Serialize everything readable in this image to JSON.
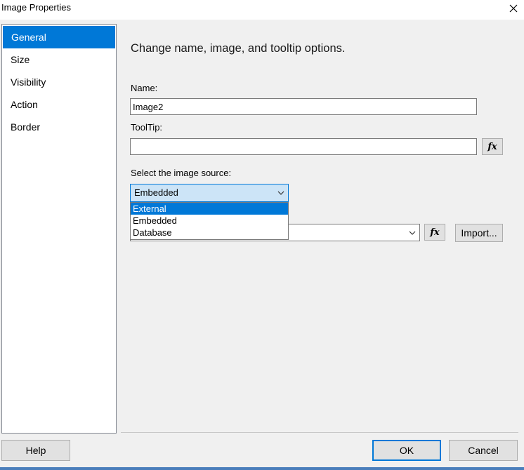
{
  "window": {
    "title": "Image Properties"
  },
  "nav": {
    "items": [
      {
        "label": "General",
        "selected": true
      },
      {
        "label": "Size",
        "selected": false
      },
      {
        "label": "Visibility",
        "selected": false
      },
      {
        "label": "Action",
        "selected": false
      },
      {
        "label": "Border",
        "selected": false
      }
    ]
  },
  "main": {
    "heading": "Change name, image, and tooltip options.",
    "name_label": "Name:",
    "name_value": "Image2",
    "tooltip_label": "ToolTip:",
    "tooltip_value": "",
    "source_label": "Select the image source:",
    "source_selected": "Embedded",
    "source_options": [
      "External",
      "Embedded",
      "Database"
    ],
    "source_highlighted": "External",
    "image_value": "",
    "fx_label": "fx",
    "import_label": "Import..."
  },
  "footer": {
    "help_label": "Help",
    "ok_label": "OK",
    "cancel_label": "Cancel"
  },
  "colors": {
    "accent": "#0078d7",
    "combo_bg": "#cce4f7",
    "dialog_bg": "#f0f0f0"
  }
}
